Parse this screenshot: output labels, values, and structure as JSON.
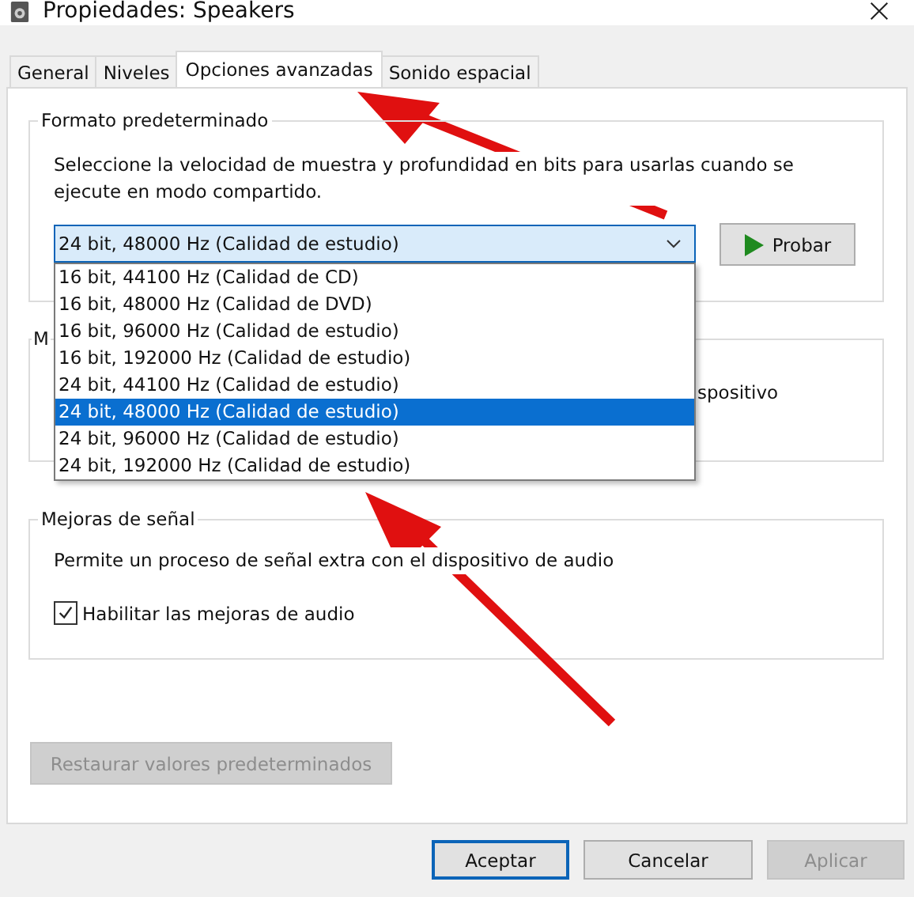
{
  "window": {
    "title": "Propiedades: Speakers"
  },
  "tabs": [
    {
      "label": "General",
      "selected": false
    },
    {
      "label": "Niveles",
      "selected": false
    },
    {
      "label": "Opciones avanzadas",
      "selected": true
    },
    {
      "label": "Sonido espacial",
      "selected": false
    }
  ],
  "format_group": {
    "title": "Formato predeterminado",
    "description": "Seleccione la velocidad de muestra y profundidad en bits para usarlas cuando se ejecute en modo compartido.",
    "combo_value": "24 bit, 48000 Hz (Calidad de estudio)",
    "expanded": true,
    "options": [
      {
        "label": "16 bit, 44100 Hz (Calidad de CD)",
        "selected": false
      },
      {
        "label": "16 bit, 48000 Hz (Calidad de DVD)",
        "selected": false
      },
      {
        "label": "16 bit, 96000 Hz (Calidad de estudio)",
        "selected": false
      },
      {
        "label": "16 bit, 192000 Hz (Calidad de estudio)",
        "selected": false
      },
      {
        "label": "24 bit, 44100 Hz (Calidad de estudio)",
        "selected": false
      },
      {
        "label": "24 bit, 48000 Hz (Calidad de estudio)",
        "selected": true
      },
      {
        "label": "24 bit, 96000 Hz (Calidad de estudio)",
        "selected": false
      },
      {
        "label": "24 bit, 192000 Hz (Calidad de estudio)",
        "selected": false
      }
    ],
    "test_button": "Probar"
  },
  "exclusive_group": {
    "title": "M",
    "text": "spositivo"
  },
  "signal_group": {
    "title": "Mejoras de señal",
    "description": "Permite un proceso de señal extra con el dispositivo de audio",
    "checkbox": {
      "label": "Habilitar las mejoras de audio",
      "checked": true
    }
  },
  "restore_button": {
    "label": "Restaurar valores predeterminados",
    "disabled": true
  },
  "buttons": [
    {
      "label": "Aceptar",
      "disabled": false,
      "default": true
    },
    {
      "label": "Cancelar",
      "disabled": false,
      "default": false
    },
    {
      "label": "Aplicar",
      "disabled": true,
      "default": false
    }
  ]
}
